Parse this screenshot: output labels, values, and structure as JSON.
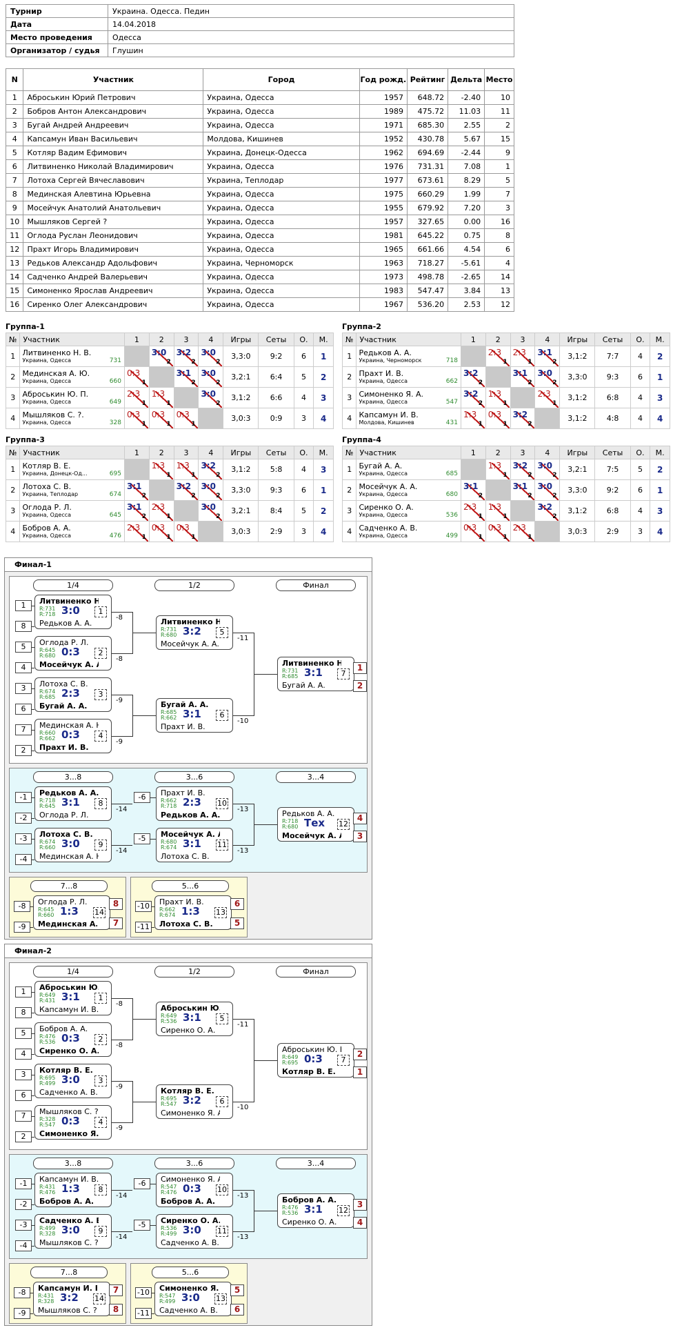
{
  "info": {
    "tournament_k": "Турнир",
    "tournament_v": "Украина. Одесса. Педин",
    "date_k": "Дата",
    "date_v": "14.04.2018",
    "place_k": "Место проведения",
    "place_v": "Одесса",
    "org_k": "Организатор / судья",
    "org_v": "Глушин"
  },
  "participants": {
    "headers": [
      "N",
      "Участник",
      "Город",
      "Год рожд.",
      "Рейтинг",
      "Дельта",
      "Место"
    ],
    "rows": [
      [
        "1",
        "Аброськин Юрий Петрович",
        "Украина, Одесса",
        "1957",
        "648.72",
        "-2.40",
        "10"
      ],
      [
        "2",
        "Бобров Антон Александрович",
        "Украина, Одесса",
        "1989",
        "475.72",
        "11.03",
        "11"
      ],
      [
        "3",
        "Бугай Андрей Андреевич",
        "Украина, Одесса",
        "1971",
        "685.30",
        "2.55",
        "2"
      ],
      [
        "4",
        "Капсамун Иван Васильевич",
        "Молдова, Кишинев",
        "1952",
        "430.78",
        "5.67",
        "15"
      ],
      [
        "5",
        "Котляр Вадим Ефимович",
        "Украина, Донецк-Одесса",
        "1962",
        "694.69",
        "-2.44",
        "9"
      ],
      [
        "6",
        "Литвиненко Николай Владимирович",
        "Украина, Одесса",
        "1976",
        "731.31",
        "7.08",
        "1"
      ],
      [
        "7",
        "Лотоха Сергей Вячеславович",
        "Украина, Теплодар",
        "1977",
        "673.61",
        "8.29",
        "5"
      ],
      [
        "8",
        "Мединская Алевтина Юрьевна",
        "Украина, Одесса",
        "1975",
        "660.29",
        "1.99",
        "7"
      ],
      [
        "9",
        "Мосейчук Анатолий Анатольевич",
        "Украина, Одесса",
        "1955",
        "679.92",
        "7.20",
        "3"
      ],
      [
        "10",
        "Мышляков Сергей ?",
        "Украина, Одесса",
        "1957",
        "327.65",
        "0.00",
        "16"
      ],
      [
        "11",
        "Оглода Руслан Леонидович",
        "Украина, Одесса",
        "1981",
        "645.22",
        "0.75",
        "8"
      ],
      [
        "12",
        "Прахт Игорь Владимирович",
        "Украина, Одесса",
        "1965",
        "661.66",
        "4.54",
        "6"
      ],
      [
        "13",
        "Редьков Александр Адольфович",
        "Украина, Черноморск",
        "1963",
        "718.27",
        "-5.61",
        "4"
      ],
      [
        "14",
        "Садченко Андрей Валерьевич",
        "Украина, Одесса",
        "1973",
        "498.78",
        "-2.65",
        "14"
      ],
      [
        "15",
        "Симоненко Ярослав Андреевич",
        "Украина, Одесса",
        "1983",
        "547.47",
        "3.84",
        "13"
      ],
      [
        "16",
        "Сиренко Олег Александрович",
        "Украина, Одесса",
        "1967",
        "536.20",
        "2.53",
        "12"
      ]
    ]
  },
  "group_headers": [
    "№",
    "Участник",
    "1",
    "2",
    "3",
    "4",
    "Игры",
    "Сеты",
    "О.",
    "М."
  ],
  "groups": [
    {
      "title": "Группа-1",
      "rows": [
        {
          "n": "1",
          "name": "Литвиненко Н. В.",
          "city": "Украина, Одесса",
          "rating": "731",
          "cells": [
            null,
            [
              "3:0",
              "2",
              "w"
            ],
            [
              "3:2",
              "2",
              "w"
            ],
            [
              "3:0",
              "2",
              "w"
            ]
          ],
          "games": "3,3:0",
          "sets": "9:2",
          "pts": "6",
          "place": "1"
        },
        {
          "n": "2",
          "name": "Мединская А. Ю.",
          "city": "Украина, Одесса",
          "rating": "660",
          "cells": [
            [
              "0:3",
              "1",
              "l"
            ],
            null,
            [
              "3:1",
              "2",
              "w"
            ],
            [
              "3:0",
              "2",
              "w"
            ]
          ],
          "games": "3,2:1",
          "sets": "6:4",
          "pts": "5",
          "place": "2"
        },
        {
          "n": "3",
          "name": "Аброськин Ю. П.",
          "city": "Украина, Одесса",
          "rating": "649",
          "cells": [
            [
              "2:3",
              "1",
              "l"
            ],
            [
              "1:3",
              "1",
              "l"
            ],
            null,
            [
              "3:0",
              "2",
              "w"
            ]
          ],
          "games": "3,1:2",
          "sets": "6:6",
          "pts": "4",
          "place": "3"
        },
        {
          "n": "4",
          "name": "Мышляков С. ?.",
          "city": "Украина, Одесса",
          "rating": "328",
          "cells": [
            [
              "0:3",
              "1",
              "l"
            ],
            [
              "0:3",
              "1",
              "l"
            ],
            [
              "0:3",
              "1",
              "l"
            ],
            null
          ],
          "games": "3,0:3",
          "sets": "0:9",
          "pts": "3",
          "place": "4"
        }
      ]
    },
    {
      "title": "Группа-2",
      "rows": [
        {
          "n": "1",
          "name": "Редьков А. А.",
          "city": "Украина, Черноморск",
          "rating": "718",
          "cells": [
            null,
            [
              "2:3",
              "1",
              "l"
            ],
            [
              "2:3",
              "1",
              "l"
            ],
            [
              "3:1",
              "2",
              "w"
            ]
          ],
          "games": "3,1:2",
          "sets": "7:7",
          "pts": "4",
          "place": "2"
        },
        {
          "n": "2",
          "name": "Прахт И. В.",
          "city": "Украина, Одесса",
          "rating": "662",
          "cells": [
            [
              "3:2",
              "2",
              "w"
            ],
            null,
            [
              "3:1",
              "2",
              "w"
            ],
            [
              "3:0",
              "2",
              "w"
            ]
          ],
          "games": "3,3:0",
          "sets": "9:3",
          "pts": "6",
          "place": "1"
        },
        {
          "n": "3",
          "name": "Симоненко Я. А.",
          "city": "Украина, Одесса",
          "rating": "547",
          "cells": [
            [
              "3:2",
              "2",
              "w"
            ],
            [
              "1:3",
              "1",
              "l"
            ],
            null,
            [
              "2:3",
              "1",
              "l"
            ]
          ],
          "games": "3,1:2",
          "sets": "6:8",
          "pts": "4",
          "place": "3"
        },
        {
          "n": "4",
          "name": "Капсамун И. В.",
          "city": "Молдова, Кишинев",
          "rating": "431",
          "cells": [
            [
              "1:3",
              "1",
              "l"
            ],
            [
              "0:3",
              "1",
              "l"
            ],
            [
              "3:2",
              "2",
              "w"
            ],
            null
          ],
          "games": "3,1:2",
          "sets": "4:8",
          "pts": "4",
          "place": "4"
        }
      ]
    },
    {
      "title": "Группа-3",
      "rows": [
        {
          "n": "1",
          "name": "Котляр В. Е.",
          "city": "Украина, Донецк-Од...",
          "rating": "695",
          "cells": [
            null,
            [
              "1:3",
              "1",
              "l"
            ],
            [
              "1:3",
              "1",
              "l"
            ],
            [
              "3:2",
              "2",
              "w"
            ]
          ],
          "games": "3,1:2",
          "sets": "5:8",
          "pts": "4",
          "place": "3"
        },
        {
          "n": "2",
          "name": "Лотоха С. В.",
          "city": "Украина, Теплодар",
          "rating": "674",
          "cells": [
            [
              "3:1",
              "2",
              "w"
            ],
            null,
            [
              "3:2",
              "2",
              "w"
            ],
            [
              "3:0",
              "2",
              "w"
            ]
          ],
          "games": "3,3:0",
          "sets": "9:3",
          "pts": "6",
          "place": "1"
        },
        {
          "n": "3",
          "name": "Оглода Р. Л.",
          "city": "Украина, Одесса",
          "rating": "645",
          "cells": [
            [
              "3:1",
              "2",
              "w"
            ],
            [
              "2:3",
              "1",
              "l"
            ],
            null,
            [
              "3:0",
              "2",
              "w"
            ]
          ],
          "games": "3,2:1",
          "sets": "8:4",
          "pts": "5",
          "place": "2"
        },
        {
          "n": "4",
          "name": "Бобров А. А.",
          "city": "Украина, Одесса",
          "rating": "476",
          "cells": [
            [
              "2:3",
              "1",
              "l"
            ],
            [
              "0:3",
              "1",
              "l"
            ],
            [
              "0:3",
              "1",
              "l"
            ],
            null
          ],
          "games": "3,0:3",
          "sets": "2:9",
          "pts": "3",
          "place": "4"
        }
      ]
    },
    {
      "title": "Группа-4",
      "rows": [
        {
          "n": "1",
          "name": "Бугай А. А.",
          "city": "Украина, Одесса",
          "rating": "685",
          "cells": [
            null,
            [
              "1:3",
              "1",
              "l"
            ],
            [
              "3:2",
              "2",
              "w"
            ],
            [
              "3:0",
              "2",
              "w"
            ]
          ],
          "games": "3,2:1",
          "sets": "7:5",
          "pts": "5",
          "place": "2"
        },
        {
          "n": "2",
          "name": "Мосейчук А. А.",
          "city": "Украина, Одесса",
          "rating": "680",
          "cells": [
            [
              "3:1",
              "2",
              "w"
            ],
            null,
            [
              "3:1",
              "2",
              "w"
            ],
            [
              "3:0",
              "2",
              "w"
            ]
          ],
          "games": "3,3:0",
          "sets": "9:2",
          "pts": "6",
          "place": "1"
        },
        {
          "n": "3",
          "name": "Сиренко О. А.",
          "city": "Украина, Одесса",
          "rating": "536",
          "cells": [
            [
              "2:3",
              "1",
              "l"
            ],
            [
              "1:3",
              "1",
              "l"
            ],
            null,
            [
              "3:2",
              "2",
              "w"
            ]
          ],
          "games": "3,1:2",
          "sets": "6:8",
          "pts": "4",
          "place": "3"
        },
        {
          "n": "4",
          "name": "Садченко А. В.",
          "city": "Украина, Одесса",
          "rating": "499",
          "cells": [
            [
              "0:3",
              "1",
              "l"
            ],
            [
              "0:3",
              "1",
              "l"
            ],
            [
              "2:3",
              "1",
              "l"
            ],
            null
          ],
          "games": "3,0:3",
          "sets": "2:9",
          "pts": "3",
          "place": "4"
        }
      ]
    }
  ],
  "finals": [
    {
      "title": "Финал-1",
      "caps": [
        "1/4",
        "1/2",
        "Финал",
        "3...8",
        "3...6",
        "3...4",
        "7...8",
        "5...6"
      ],
      "seeds": [
        "1",
        "8",
        "5",
        "4",
        "3",
        "6",
        "7",
        "2",
        "-1",
        "-2",
        "-3",
        "-4",
        "-6",
        "-5",
        "-8",
        "-9",
        "-10",
        "-11"
      ],
      "matches": [
        {
          "a": "Литвиненко Н....",
          "ra": "R:731",
          "b": "Редьков А. А.",
          "rb": "R:718",
          "s": "3:0",
          "g": "1",
          "w": "a",
          "lbl": "-8"
        },
        {
          "a": "Оглода Р. Л.",
          "ra": "R:645",
          "b": "Мосейчук А. А.",
          "rb": "R:680",
          "s": "0:3",
          "g": "2",
          "w": "b",
          "lbl": "-8"
        },
        {
          "a": "Лотоха С. В.",
          "ra": "R:674",
          "b": "Бугай А. А.",
          "rb": "R:685",
          "s": "2:3",
          "g": "3",
          "w": "b",
          "lbl": "-9"
        },
        {
          "a": "Мединская А. Ю.",
          "ra": "R:660",
          "b": "Прахт И. В.",
          "rb": "R:662",
          "s": "0:3",
          "g": "4",
          "w": "b",
          "lbl": "-9"
        },
        {
          "a": "Литвиненко Н....",
          "ra": "R:731",
          "b": "Мосейчук А. А.",
          "rb": "R:680",
          "s": "3:2",
          "g": "5",
          "w": "a",
          "lbl": "-11"
        },
        {
          "a": "Бугай А. А.",
          "ra": "R:685",
          "b": "Прахт И. В.",
          "rb": "R:662",
          "s": "3:1",
          "g": "6",
          "w": "a",
          "lbl": "-10"
        },
        {
          "a": "Литвиненко Н....",
          "ra": "R:731",
          "b": "Бугай А. А.",
          "rb": "R:685",
          "s": "3:1",
          "g": "7",
          "w": "a",
          "lbl": ""
        },
        {
          "a": "Редьков А. А.",
          "ra": "R:718",
          "b": "Оглода Р. Л.",
          "rb": "R:645",
          "s": "3:1",
          "g": "8",
          "w": "a",
          "lbl": "-14"
        },
        {
          "a": "Лотоха С. В.",
          "ra": "R:674",
          "b": "Мединская А. Ю.",
          "rb": "R:660",
          "s": "3:0",
          "g": "9",
          "w": "a",
          "lbl": "-14"
        },
        {
          "a": "Прахт И. В.",
          "ra": "R:662",
          "b": "Редьков А. А.",
          "rb": "R:718",
          "s": "2:3",
          "g": "10",
          "w": "b",
          "lbl": "-13"
        },
        {
          "a": "Мосейчук А. А.",
          "ra": "R:680",
          "b": "Лотоха С. В.",
          "rb": "R:674",
          "s": "3:1",
          "g": "11",
          "w": "a",
          "lbl": "-13"
        },
        {
          "a": "Редьков А. А.",
          "ra": "R:718",
          "b": "Мосейчук А. А.",
          "rb": "R:680",
          "s": "Тех",
          "g": "12",
          "w": "b",
          "lbl": ""
        },
        {
          "a": "Оглода Р. Л.",
          "ra": "R:645",
          "b": "Мединская А. Ю.",
          "rb": "R:660",
          "s": "1:3",
          "g": "14",
          "w": "b",
          "lbl": ""
        },
        {
          "a": "Прахт И. В.",
          "ra": "R:662",
          "b": "Лотоха С. В.",
          "rb": "R:674",
          "s": "1:3",
          "g": "13",
          "w": "b",
          "lbl": ""
        }
      ],
      "places": [
        "1",
        "2",
        "4",
        "3",
        "8",
        "7",
        "6",
        "5"
      ]
    },
    {
      "title": "Финал-2",
      "caps": [
        "1/4",
        "1/2",
        "Финал",
        "3...8",
        "3...6",
        "3...4",
        "7...8",
        "5...6"
      ],
      "seeds": [
        "1",
        "8",
        "5",
        "4",
        "3",
        "6",
        "7",
        "2",
        "-1",
        "-2",
        "-3",
        "-4",
        "-6",
        "-5",
        "-8",
        "-9",
        "-10",
        "-11"
      ],
      "matches": [
        {
          "a": "Аброськин Ю. П.",
          "ra": "R:649",
          "b": "Капсамун И. В.",
          "rb": "R:431",
          "s": "3:1",
          "g": "1",
          "w": "a",
          "lbl": "-8"
        },
        {
          "a": "Бобров А. А.",
          "ra": "R:476",
          "b": "Сиренко О. А.",
          "rb": "R:536",
          "s": "0:3",
          "g": "2",
          "w": "b",
          "lbl": "-8"
        },
        {
          "a": "Котляр В. Е.",
          "ra": "R:695",
          "b": "Садченко А. В.",
          "rb": "R:499",
          "s": "3:0",
          "g": "3",
          "w": "a",
          "lbl": "-9"
        },
        {
          "a": "Мышляков С. ?.",
          "ra": "R:328",
          "b": "Симоненко Я. А.",
          "rb": "R:547",
          "s": "0:3",
          "g": "4",
          "w": "b",
          "lbl": "-9"
        },
        {
          "a": "Аброськин Ю. П.",
          "ra": "R:649",
          "b": "Сиренко О. А.",
          "rb": "R:536",
          "s": "3:1",
          "g": "5",
          "w": "a",
          "lbl": "-11"
        },
        {
          "a": "Котляр В. Е.",
          "ra": "R:695",
          "b": "Симоненко Я. А.",
          "rb": "R:547",
          "s": "3:2",
          "g": "6",
          "w": "a",
          "lbl": "-10"
        },
        {
          "a": "Аброськин Ю. П.",
          "ra": "R:649",
          "b": "Котляр В. Е.",
          "rb": "R:695",
          "s": "0:3",
          "g": "7",
          "w": "b",
          "lbl": ""
        },
        {
          "a": "Капсамун И. В.",
          "ra": "R:431",
          "b": "Бобров А. А.",
          "rb": "R:476",
          "s": "1:3",
          "g": "8",
          "w": "b",
          "lbl": "-14"
        },
        {
          "a": "Садченко А. В.",
          "ra": "R:499",
          "b": "Мышляков С. ?.",
          "rb": "R:328",
          "s": "3:0",
          "g": "9",
          "w": "a",
          "lbl": "-14"
        },
        {
          "a": "Симоненко Я. А.",
          "ra": "R:547",
          "b": "Бобров А. А.",
          "rb": "R:476",
          "s": "0:3",
          "g": "10",
          "w": "b",
          "lbl": "-13"
        },
        {
          "a": "Сиренко О. А.",
          "ra": "R:536",
          "b": "Садченко А. В.",
          "rb": "R:499",
          "s": "3:0",
          "g": "11",
          "w": "a",
          "lbl": "-13"
        },
        {
          "a": "Бобров А. А.",
          "ra": "R:476",
          "b": "Сиренко О. А.",
          "rb": "R:536",
          "s": "3:1",
          "g": "12",
          "w": "a",
          "lbl": ""
        },
        {
          "a": "Капсамун И. В.",
          "ra": "R:431",
          "b": "Мышляков С. ?.",
          "rb": "R:328",
          "s": "3:2",
          "g": "14",
          "w": "a",
          "lbl": ""
        },
        {
          "a": "Симоненко Я. А.",
          "ra": "R:547",
          "b": "Садченко А. В.",
          "rb": "R:499",
          "s": "3:0",
          "g": "13",
          "w": "a",
          "lbl": ""
        }
      ],
      "places": [
        "2",
        "1",
        "3",
        "4",
        "7",
        "8",
        "5",
        "6"
      ]
    }
  ],
  "colors": {
    "win": "#1a2a8a",
    "loss": "#b81c1c",
    "rating": "#2d8a2d",
    "cyan_section": "#e4f8fb",
    "yellow_section": "#fdfbd9",
    "place_red": "#a01818"
  }
}
